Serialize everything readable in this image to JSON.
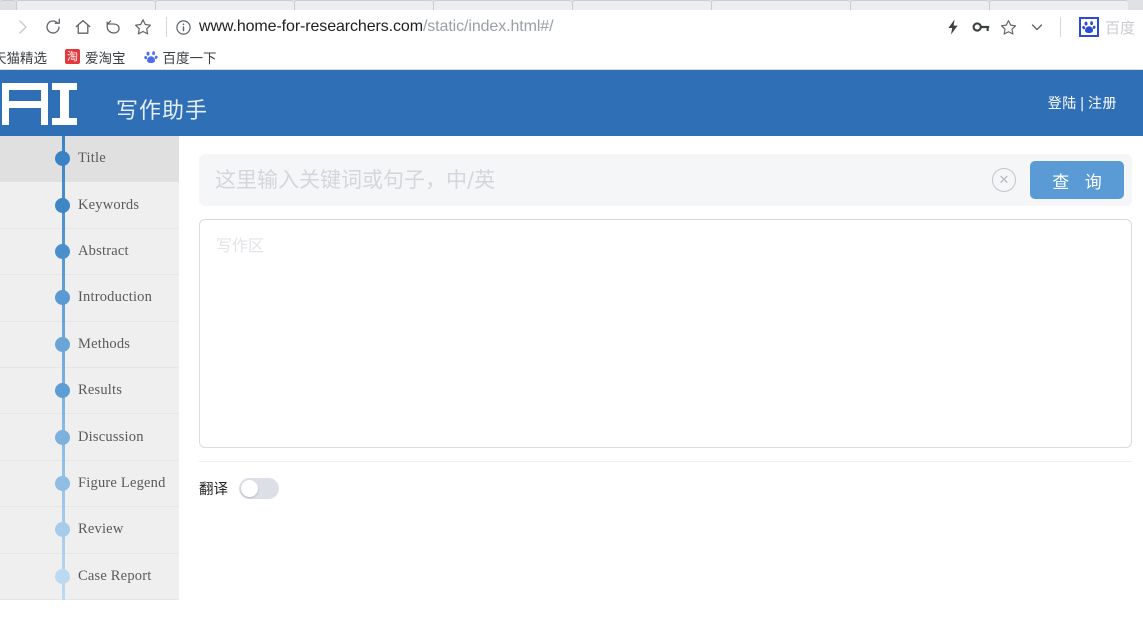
{
  "browser": {
    "nav": {
      "forward_icon": "forward-arrow-icon",
      "reload_icon": "reload-icon",
      "home_icon": "home-icon",
      "back_icon": "undo-arrow-icon",
      "bookmark_icon": "star-icon"
    },
    "url": {
      "info_icon": "info-circle-icon",
      "domain": "www.home-for-researchers.com",
      "path": "/static/index.html#/"
    },
    "extensions": {
      "flash_icon": "lightning-icon",
      "key_icon": "key-icon",
      "star_icon": "star-outline-icon",
      "chevron_icon": "chevron-down-icon",
      "baidu_icon": "baidu-paw-icon",
      "baidu_label": "百度"
    },
    "bookmarks": [
      {
        "label": "天猫精选",
        "icon": "tmall-icon"
      },
      {
        "label": "爱淘宝",
        "icon": "taobao-icon"
      },
      {
        "label": "百度一下",
        "icon": "baidu-paw-icon"
      }
    ]
  },
  "site": {
    "logo_mark": "AI",
    "logo_text": "写作助手",
    "auth": {
      "login": "登陆",
      "separator": "|",
      "register": "注册"
    },
    "colors": {
      "header_blue": "#2f6fb5",
      "button_blue": "#5b9bd5",
      "sidebar_bg": "#efefef",
      "active_row": "#e0e0e0"
    }
  },
  "sidebar": {
    "items": [
      {
        "label": "Title",
        "dot_color": "#3b82c4",
        "active": true
      },
      {
        "label": "Keywords",
        "dot_color": "#3f86c7",
        "active": false
      },
      {
        "label": "Abstract",
        "dot_color": "#4a8ecc",
        "active": false
      },
      {
        "label": "Introduction",
        "dot_color": "#5a99d2",
        "active": false
      },
      {
        "label": "Methods",
        "dot_color": "#6ba5d8",
        "active": false
      },
      {
        "label": "Results",
        "dot_color": "#5e9cd4",
        "active": false
      },
      {
        "label": "Discussion",
        "dot_color": "#7cb1de",
        "active": false
      },
      {
        "label": "Figure Legend",
        "dot_color": "#8fbde4",
        "active": false
      },
      {
        "label": "Review",
        "dot_color": "#a6cbeb",
        "active": false
      },
      {
        "label": "Case Report",
        "dot_color": "#bcd9f2",
        "active": false
      }
    ]
  },
  "main": {
    "search": {
      "value": "",
      "placeholder": "这里输入关键词或句子，中/英",
      "clear_icon": "clear-circle-icon",
      "button_label": "查 询"
    },
    "editor": {
      "value": "",
      "placeholder": "写作区"
    },
    "translate": {
      "label": "翻译",
      "state": "off"
    }
  }
}
